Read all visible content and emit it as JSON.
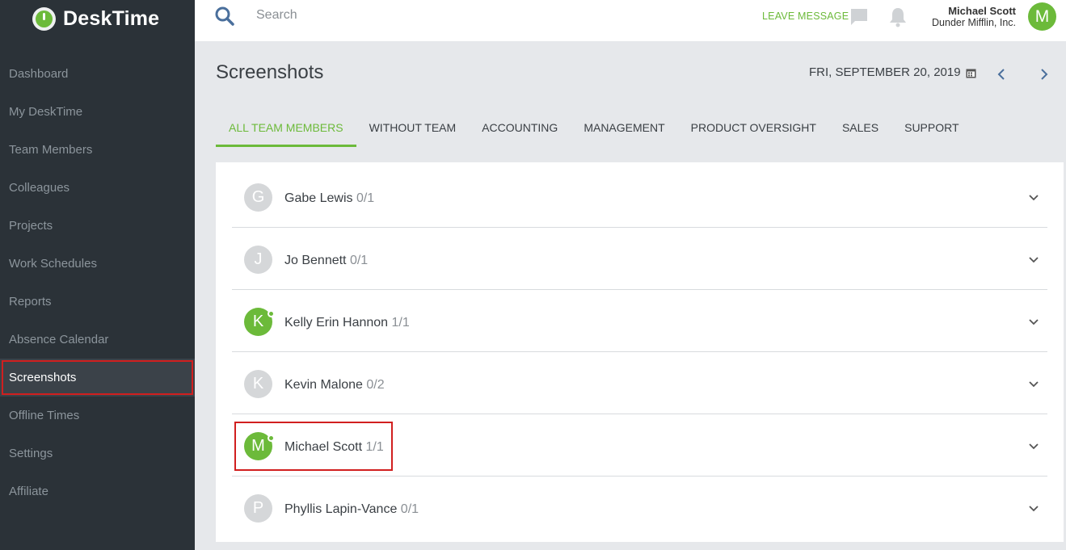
{
  "app": {
    "name": "DeskTime"
  },
  "sidebar": {
    "items": [
      {
        "label": "Dashboard",
        "id": "dashboard"
      },
      {
        "label": "My DeskTime",
        "id": "my-desktime"
      },
      {
        "label": "Team Members",
        "id": "team-members"
      },
      {
        "label": "Colleagues",
        "id": "colleagues"
      },
      {
        "label": "Projects",
        "id": "projects"
      },
      {
        "label": "Work Schedules",
        "id": "work-schedules"
      },
      {
        "label": "Reports",
        "id": "reports"
      },
      {
        "label": "Absence Calendar",
        "id": "absence-calendar"
      },
      {
        "label": "Screenshots",
        "id": "screenshots",
        "active": true
      },
      {
        "label": "Offline Times",
        "id": "offline-times"
      },
      {
        "label": "Settings",
        "id": "settings"
      },
      {
        "label": "Affiliate",
        "id": "affiliate"
      }
    ]
  },
  "topbar": {
    "search_placeholder": "Search",
    "leave_message": "LEAVE MESSAGE",
    "user_name": "Michael Scott",
    "user_company": "Dunder Mifflin, Inc.",
    "user_initial": "M"
  },
  "page": {
    "title": "Screenshots",
    "date": "FRI, SEPTEMBER 20, 2019"
  },
  "tabs": [
    {
      "label": "ALL TEAM MEMBERS",
      "active": true
    },
    {
      "label": "WITHOUT TEAM"
    },
    {
      "label": "ACCOUNTING"
    },
    {
      "label": "MANAGEMENT"
    },
    {
      "label": "PRODUCT OVERSIGHT"
    },
    {
      "label": "SALES"
    },
    {
      "label": "SUPPORT"
    }
  ],
  "members": [
    {
      "initial": "G",
      "name": "Gabe Lewis",
      "count": "0/1",
      "online": false
    },
    {
      "initial": "J",
      "name": "Jo Bennett",
      "count": "0/1",
      "online": false
    },
    {
      "initial": "K",
      "name": "Kelly Erin Hannon",
      "count": "1/1",
      "online": true
    },
    {
      "initial": "K",
      "name": "Kevin Malone",
      "count": "0/2",
      "online": false
    },
    {
      "initial": "M",
      "name": "Michael Scott",
      "count": "1/1",
      "online": true
    },
    {
      "initial": "P",
      "name": "Phyllis Lapin-Vance",
      "count": "0/1",
      "online": false
    }
  ],
  "colors": {
    "accent": "#6cba3a",
    "sidebar_bg": "#2b3238",
    "highlight": "#d11f1f"
  }
}
